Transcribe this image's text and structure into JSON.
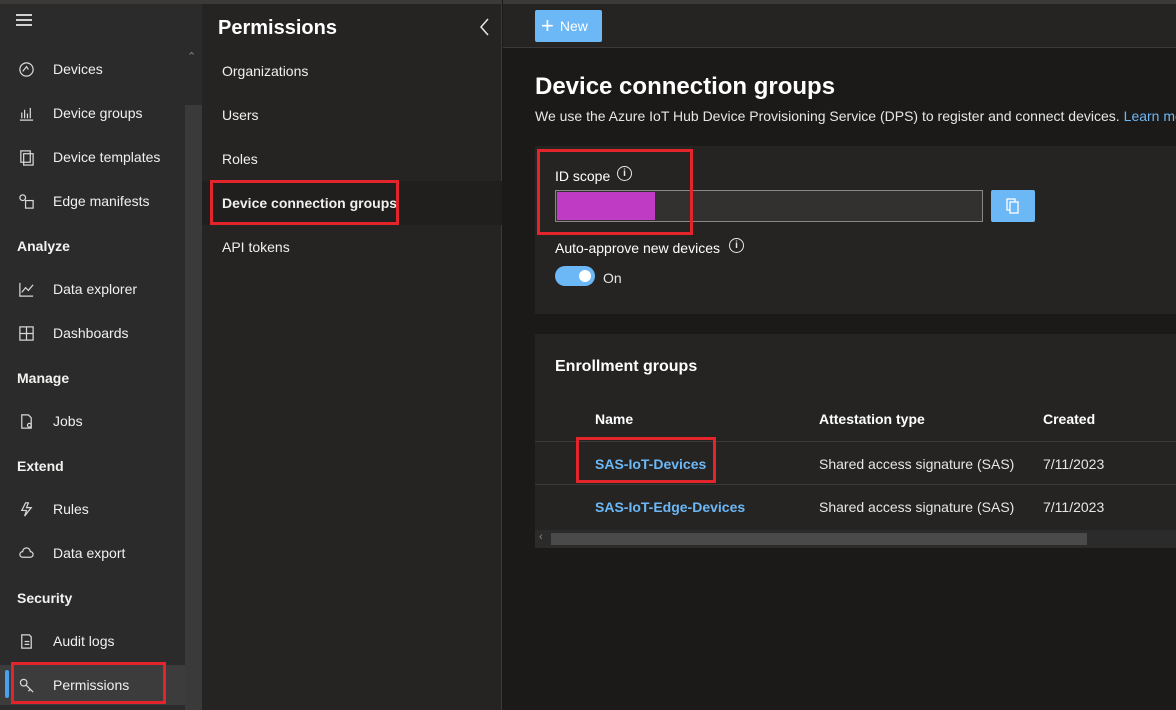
{
  "nav": {
    "items": [
      {
        "label": "Devices",
        "icon": "devices-icon"
      },
      {
        "label": "Device groups",
        "icon": "device-groups-icon"
      },
      {
        "label": "Device templates",
        "icon": "device-templates-icon"
      },
      {
        "label": "Edge manifests",
        "icon": "edge-manifests-icon"
      }
    ],
    "sections": {
      "analyze": "Analyze",
      "manage": "Manage",
      "extend": "Extend",
      "security": "Security"
    },
    "analyze_items": [
      {
        "label": "Data explorer",
        "icon": "chart-line-icon"
      },
      {
        "label": "Dashboards",
        "icon": "dashboard-icon"
      }
    ],
    "manage_items": [
      {
        "label": "Jobs",
        "icon": "document-icon"
      }
    ],
    "extend_items": [
      {
        "label": "Rules",
        "icon": "rules-icon"
      },
      {
        "label": "Data export",
        "icon": "cloud-export-icon"
      }
    ],
    "security_items": [
      {
        "label": "Audit logs",
        "icon": "audit-icon"
      },
      {
        "label": "Permissions",
        "icon": "key-icon"
      }
    ]
  },
  "permissions": {
    "title": "Permissions",
    "items": [
      "Organizations",
      "Users",
      "Roles",
      "Device connection groups",
      "API tokens"
    ],
    "selected": "Device connection groups"
  },
  "toolbar": {
    "new_label": "New"
  },
  "page": {
    "title": "Device connection groups",
    "description": "We use the Azure IoT Hub Device Provisioning Service (DPS) to register and connect devices.",
    "learn_more": "Learn more"
  },
  "id_scope": {
    "label": "ID scope",
    "info_glyph": "i"
  },
  "auto_approve": {
    "label": "Auto-approve new devices",
    "state": "On",
    "info_glyph": "i"
  },
  "enrollment": {
    "title": "Enrollment groups",
    "columns": [
      "Name",
      "Attestation type",
      "Created"
    ],
    "rows": [
      {
        "name": "SAS-IoT-Devices",
        "attestation": "Shared access signature (SAS)",
        "created": "7/11/2023"
      },
      {
        "name": "SAS-IoT-Edge-Devices",
        "attestation": "Shared access signature (SAS)",
        "created": "7/11/2023"
      }
    ]
  },
  "colors": {
    "accent": "#6cb8f6",
    "highlight_box": "#e3242b",
    "redacted": "#c03bc4"
  }
}
